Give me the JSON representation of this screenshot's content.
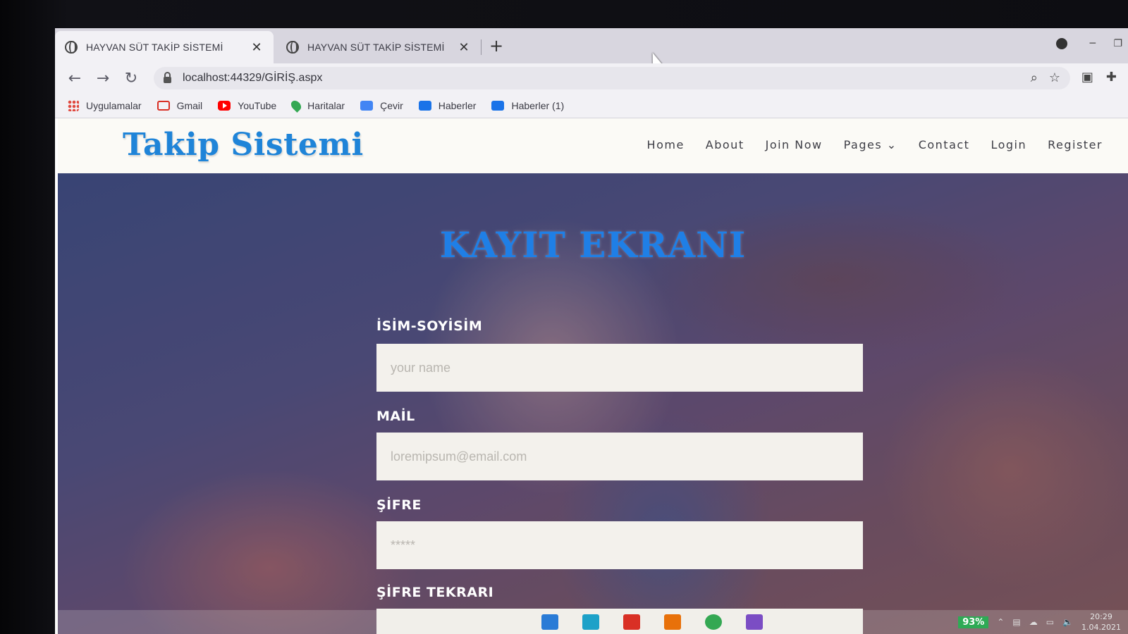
{
  "browser": {
    "tabs": [
      {
        "title": "HAYVAN SÜT TAKİP SİSTEMİ",
        "active": true
      },
      {
        "title": "HAYVAN SÜT TAKİP SİSTEMİ",
        "active": false
      }
    ],
    "new_tab": "+",
    "close_glyph": "✕",
    "url": "localhost:44329/GİRİŞ.aspx",
    "bookmarks": [
      {
        "label": "Uygulamalar",
        "icon": "apps-grid-icon"
      },
      {
        "label": "Gmail",
        "icon": "gmail-icon"
      },
      {
        "label": "YouTube",
        "icon": "youtube-icon"
      },
      {
        "label": "Haritalar",
        "icon": "maps-icon"
      },
      {
        "label": "Çevir",
        "icon": "translate-icon"
      },
      {
        "label": "Haberler",
        "icon": "news-icon"
      },
      {
        "label": "Haberler (1)",
        "icon": "news-icon"
      }
    ]
  },
  "site": {
    "logo": "Takip Sistemi",
    "logo_color": "#1f84d8",
    "menu": [
      "Home",
      "About",
      "Join Now",
      "Pages",
      "Contact",
      "Login",
      "Register"
    ],
    "pages_caret": "⌄"
  },
  "form": {
    "title": "KAYIT EKRANI",
    "title_color": "#1f7fe6",
    "fields": [
      {
        "label": "İSİM-SOYİSİM",
        "placeholder": "your name",
        "type": "text"
      },
      {
        "label": "MAİL",
        "placeholder": "loremipsum@email.com",
        "type": "email"
      },
      {
        "label": "ŞİFRE",
        "placeholder": "*****",
        "type": "password"
      },
      {
        "label": "ŞİFRE TEKRARI",
        "placeholder": "",
        "type": "password"
      }
    ]
  },
  "taskbar": {
    "battery": "93%",
    "time": "20:29",
    "date": "1.04.2021"
  }
}
